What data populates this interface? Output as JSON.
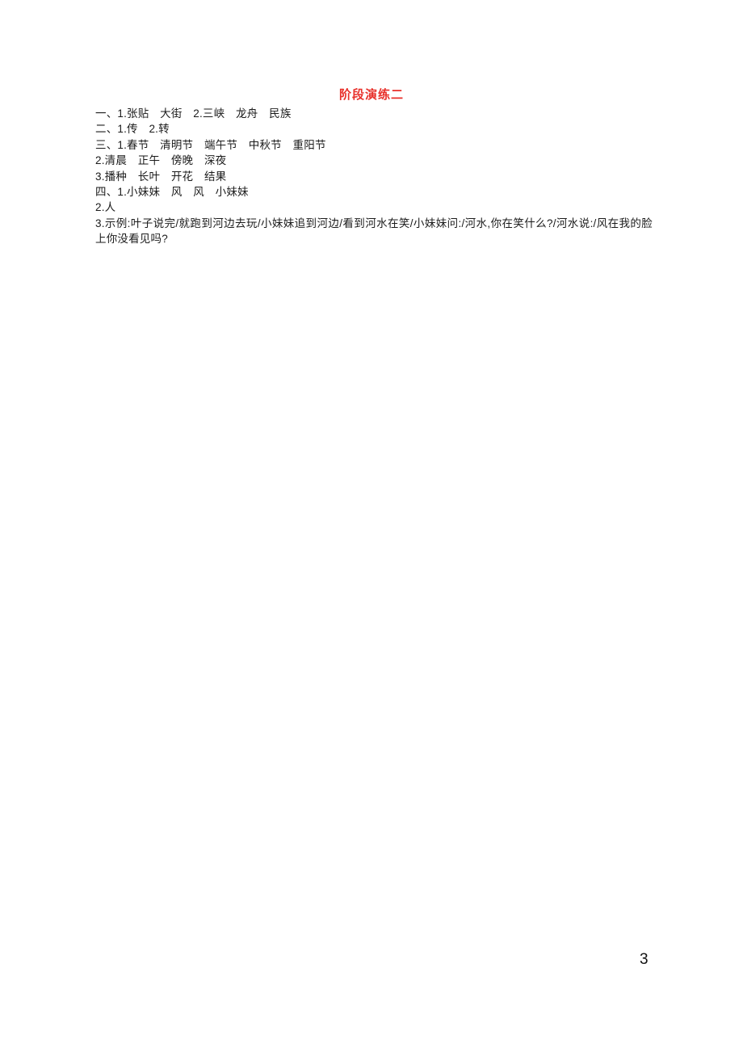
{
  "document": {
    "title": "阶段演练二",
    "title_color": "#e8302a",
    "page_number": "3",
    "background_color": "#ffffff",
    "text_color": "#1b1b1b"
  },
  "answers": [
    {
      "id": "section-1-item-1",
      "text": "一、1.张贴　大街　2.三峡　龙舟　民族"
    },
    {
      "id": "section-2-item-1",
      "text": "二、1.传　2.转"
    },
    {
      "id": "section-3-item-1",
      "text": "三、1.春节　清明节　端午节　中秋节　重阳节"
    },
    {
      "id": "section-3-item-2",
      "text": "2.清晨　正午　傍晚　深夜"
    },
    {
      "id": "section-3-item-3",
      "text": "3.播种　长叶　开花　结果"
    },
    {
      "id": "section-4-item-1",
      "text": "四、1.小妹妹　风　风　小妹妹"
    },
    {
      "id": "section-4-item-2",
      "text": "2.人"
    },
    {
      "id": "section-4-item-3",
      "text": "3.示例:叶子说完/就跑到河边去玩/小妹妹追到河边/看到河水在笑/小妹妹问:/河水,你在笑什么?/河水说:/风在我的脸上你没看见吗?"
    }
  ]
}
